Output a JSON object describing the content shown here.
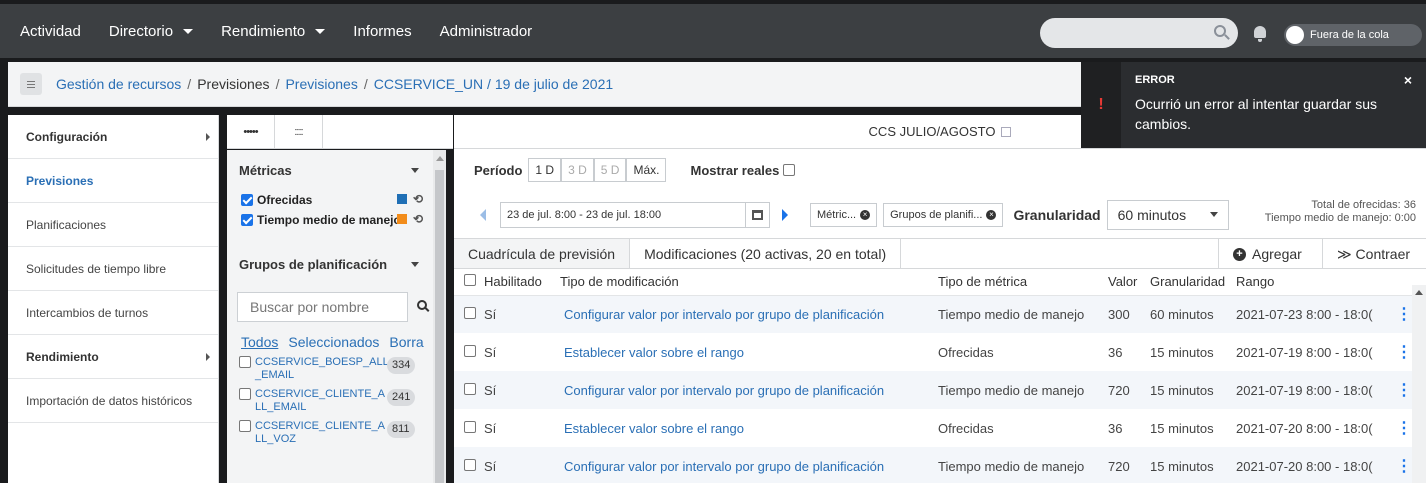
{
  "nav": {
    "items": [
      {
        "label": "Actividad",
        "dropdown": false
      },
      {
        "label": "Directorio",
        "dropdown": true
      },
      {
        "label": "Rendimiento",
        "dropdown": true
      },
      {
        "label": "Informes",
        "dropdown": false
      },
      {
        "label": "Administrador",
        "dropdown": false
      }
    ],
    "search_placeholder": "",
    "status_toggle": "Fuera de la cola"
  },
  "breadcrumb": {
    "items": [
      "Gestión de recursos",
      "Previsiones",
      "Previsiones",
      "CCSERVICE_UN / 19 de julio de 2021"
    ]
  },
  "sidebar": {
    "items": [
      {
        "label": "Configuración",
        "style": "bold",
        "arrow": true
      },
      {
        "label": "Previsiones",
        "style": "active",
        "arrow": false
      },
      {
        "label": "Planificaciones",
        "style": "normal",
        "arrow": false
      },
      {
        "label": "Solicitudes de tiempo libre",
        "style": "normal",
        "arrow": false
      },
      {
        "label": "Intercambios de turnos",
        "style": "normal",
        "arrow": false
      },
      {
        "label": "Rendimiento",
        "style": "bold",
        "arrow": true
      },
      {
        "label": "Importación de datos históricos",
        "style": "normal",
        "arrow": false
      }
    ]
  },
  "view_tabs": [
    "•••••",
    "::::"
  ],
  "metrics": {
    "title": "Métricas",
    "items": [
      {
        "label": "Ofrecidas",
        "checked": true,
        "color": "#1f6fb5"
      },
      {
        "label": "Tiempo medio de manejo",
        "checked": true,
        "color": "#f28c1a"
      }
    ]
  },
  "groups": {
    "title": "Grupos de planificación",
    "search_placeholder": "Buscar por nombre",
    "filters": [
      "Todos",
      "Seleccionados",
      "Borra"
    ],
    "items": [
      {
        "line1": "CCSERVICE_BOESP_ALL",
        "line2": "_EMAIL",
        "count": "334"
      },
      {
        "line1": "CCSERVICE_CLIENTE_A",
        "line2": "LL_EMAIL",
        "count": "241"
      },
      {
        "line1": "CCSERVICE_CLIENTE_A",
        "line2": "LL_VOZ",
        "count": "811"
      }
    ]
  },
  "main": {
    "title": "CCS JULIO/AGOSTO",
    "period_label": "Período",
    "period_buttons": [
      {
        "label": "1 D",
        "state": "active"
      },
      {
        "label": "3 D",
        "state": "dim"
      },
      {
        "label": "5 D",
        "state": "dim"
      },
      {
        "label": "Máx.",
        "state": "normal"
      }
    ],
    "show_real_label": "Mostrar reales",
    "date_range": "23 de jul. 8:00 - 23 de jul. 18:00",
    "chips": [
      "Métric...",
      "Grupos de planifi..."
    ],
    "granularity_label": "Granularidad",
    "granularity_value": "60 minutos",
    "totals": [
      "Total de ofrecidas: 36",
      "Tiempo medio de manejo: 0:00"
    ],
    "tabs": [
      "Cuadrícula de previsión",
      "Modificaciones (20 activas, 20 en total)"
    ],
    "add_button": "Agregar",
    "collapse_button": "≫ Contraer",
    "table": {
      "headers": [
        "Habilitado",
        "Tipo de modificación",
        "Tipo de métrica",
        "Valor",
        "Granularidad",
        "Rango"
      ],
      "rows": [
        [
          "Sí",
          "Configurar valor por intervalo por grupo de planificación",
          "Tiempo medio de manejo",
          "300",
          "60 minutos",
          "2021-07-23 8:00 - 18:0("
        ],
        [
          "Sí",
          "Establecer valor sobre el rango",
          "Ofrecidas",
          "36",
          "15 minutos",
          "2021-07-19 8:00 - 18:0("
        ],
        [
          "Sí",
          "Configurar valor por intervalo por grupo de planificación",
          "Tiempo medio de manejo",
          "720",
          "15 minutos",
          "2021-07-19 8:00 - 18:0("
        ],
        [
          "Sí",
          "Establecer valor sobre el rango",
          "Ofrecidas",
          "36",
          "15 minutos",
          "2021-07-20 8:00 - 18:0("
        ],
        [
          "Sí",
          "Configurar valor por intervalo por grupo de planificación",
          "Tiempo medio de manejo",
          "720",
          "15 minutos",
          "2021-07-20 8:00 - 18:0("
        ]
      ]
    }
  },
  "toast": {
    "title": "ERROR",
    "message": "Ocurrió un error al intentar guardar sus cambios.",
    "icon": "!",
    "close": "×"
  }
}
